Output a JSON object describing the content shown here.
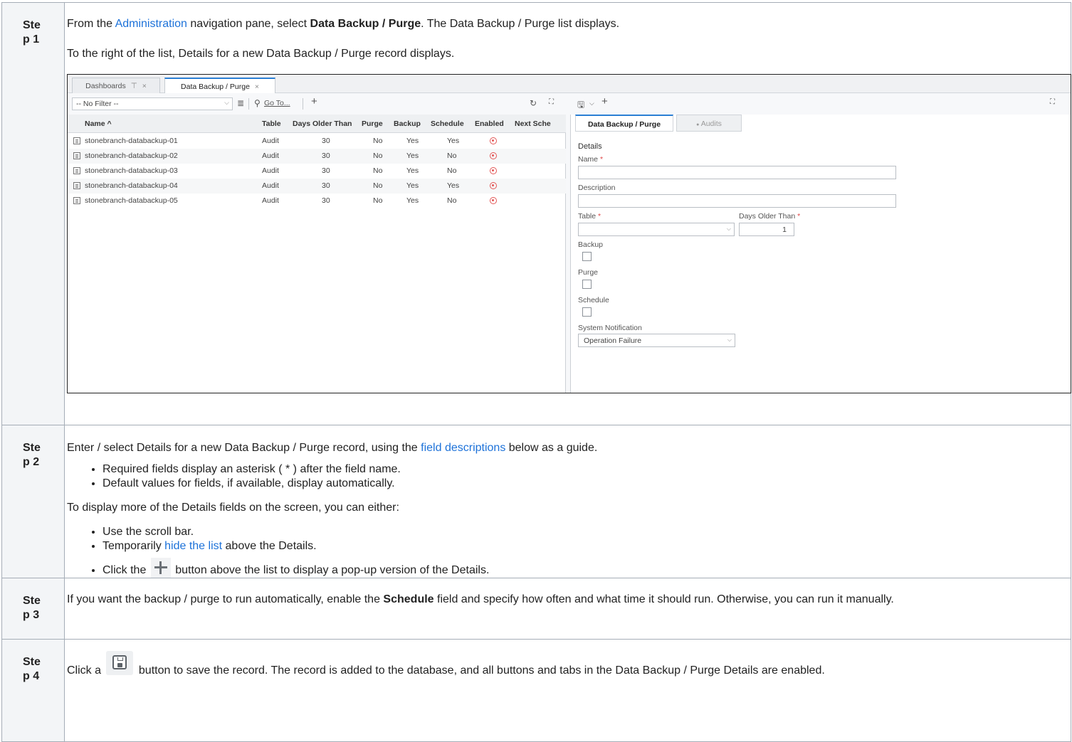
{
  "steps": [
    {
      "label": "Step 1"
    },
    {
      "label": "Step 2"
    },
    {
      "label": "Step 3"
    },
    {
      "label": "Step 4"
    }
  ],
  "step1": {
    "p1_pre": "From the ",
    "p1_link": "Administration",
    "p1_mid": " navigation pane, select ",
    "p1_bold": "Data Backup / Purge",
    "p1_post": ". The Data Backup / Purge list displays.",
    "p2": "To the right of the list, Details for a new Data Backup / Purge record displays."
  },
  "shot": {
    "tabs": [
      {
        "label": "Dashboards",
        "pin": "⊤",
        "close": "×"
      },
      {
        "label": "Data Backup / Purge",
        "close": "×"
      }
    ],
    "filter": "-- No Filter --",
    "goto": "Go To...",
    "list_columns": [
      "Name ^",
      "Table",
      "Days Older Than",
      "Purge",
      "Backup",
      "Schedule",
      "Enabled",
      "Next Sche"
    ],
    "rows": [
      {
        "name": "stonebranch-databackup-01",
        "table": "Audit",
        "days": "30",
        "purge": "No",
        "backup": "Yes",
        "schedule": "Yes"
      },
      {
        "name": "stonebranch-databackup-02",
        "table": "Audit",
        "days": "30",
        "purge": "No",
        "backup": "Yes",
        "schedule": "No"
      },
      {
        "name": "stonebranch-databackup-03",
        "table": "Audit",
        "days": "30",
        "purge": "No",
        "backup": "Yes",
        "schedule": "No"
      },
      {
        "name": "stonebranch-databackup-04",
        "table": "Audit",
        "days": "30",
        "purge": "No",
        "backup": "Yes",
        "schedule": "Yes"
      },
      {
        "name": "stonebranch-databackup-05",
        "table": "Audit",
        "days": "30",
        "purge": "No",
        "backup": "Yes",
        "schedule": "No"
      }
    ],
    "detail_tabs": [
      "Data Backup / Purge",
      "Audits"
    ],
    "details_title": "Details",
    "fields": {
      "name": "Name",
      "description": "Description",
      "table": "Table",
      "days_older_than": "Days Older Than",
      "days_value": "1",
      "backup": "Backup",
      "purge": "Purge",
      "schedule": "Schedule",
      "system_notification": "System Notification",
      "system_notification_value": "Operation Failure",
      "required_mark": "*"
    }
  },
  "step2": {
    "p1_pre": "Enter / select Details for a new Data Backup / Purge record, using the ",
    "p1_link": "field descriptions",
    "p1_post": " below as a guide.",
    "bullets1": [
      "Required fields display an asterisk ( * ) after the field name.",
      "Default values for fields, if available, display automatically."
    ],
    "p2": "To display more of the Details fields on the screen, you can either:",
    "b2_1": "Use the scroll bar.",
    "b2_2_pre": "Temporarily ",
    "b2_2_link": "hide the list",
    "b2_2_post": " above the Details.",
    "b2_3_pre": "Click the ",
    "b2_3_post": " button above the list to display a pop-up version of the Details."
  },
  "step3": {
    "pre": "If you want the backup / purge to run automatically, enable the ",
    "bold": "Schedule",
    "post": " field and specify how often and what time it should run. Otherwise, you can run it manually."
  },
  "step4": {
    "pre": "Click a ",
    "post": " button to save the record. The record is added to the database, and all buttons and tabs in the Data Backup / Purge Details are enabled."
  },
  "colors": {
    "link": "#1d72d9",
    "required": "#e04848",
    "enabled_icon": "#e35757"
  }
}
